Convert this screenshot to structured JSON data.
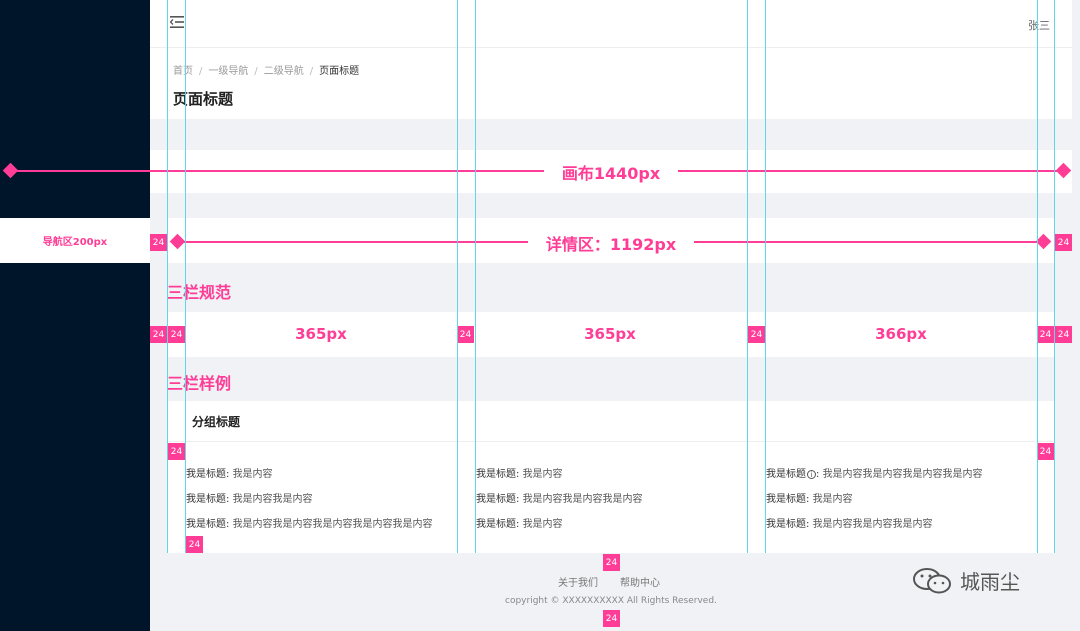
{
  "header": {
    "user_name": "张三"
  },
  "breadcrumb": {
    "items": [
      "首页",
      "一级导航",
      "二级导航"
    ],
    "current": "页面标题",
    "separator": "/"
  },
  "page": {
    "title": "页面标题"
  },
  "annotations": {
    "canvas_label": "画布1440px",
    "nav_label": "导航区200px",
    "detail_label": "详情区：1192px",
    "section_spec": "三栏规范",
    "section_sample": "三栏样例",
    "gap": "24",
    "columns": [
      "365px",
      "365px",
      "366px"
    ]
  },
  "sample": {
    "group_title": "分组标题",
    "col1": [
      {
        "k": "我是标题:",
        "v": "我是内容"
      },
      {
        "k": "我是标题:",
        "v": "我是内容我是内容"
      },
      {
        "k": "我是标题:",
        "v": "我是内容我是内容我是内容我是内容我是内容"
      }
    ],
    "col2": [
      {
        "k": "我是标题:",
        "v": "我是内容"
      },
      {
        "k": "我是标题:",
        "v": "我是内容我是内容我是内容"
      },
      {
        "k": "我是标题:",
        "v": "我是内容"
      }
    ],
    "col3": [
      {
        "k": "我是标题",
        "info": "i",
        "k2": ":",
        "v": "我是内容我是内容我是内容我是内容"
      },
      {
        "k": "我是标题:",
        "v": "我是内容"
      },
      {
        "k": "我是标题:",
        "v": "我是内容我是内容我是内容"
      }
    ]
  },
  "footer": {
    "links": [
      "关于我们",
      "帮助中心"
    ],
    "copyright": "copyright © XXXXXXXXXX All Rights Reserved."
  },
  "watermark": {
    "text": "城雨尘"
  },
  "colors": {
    "accent": "#ff3d96",
    "sidebar": "#001529",
    "guide": "#5fd7e8"
  }
}
